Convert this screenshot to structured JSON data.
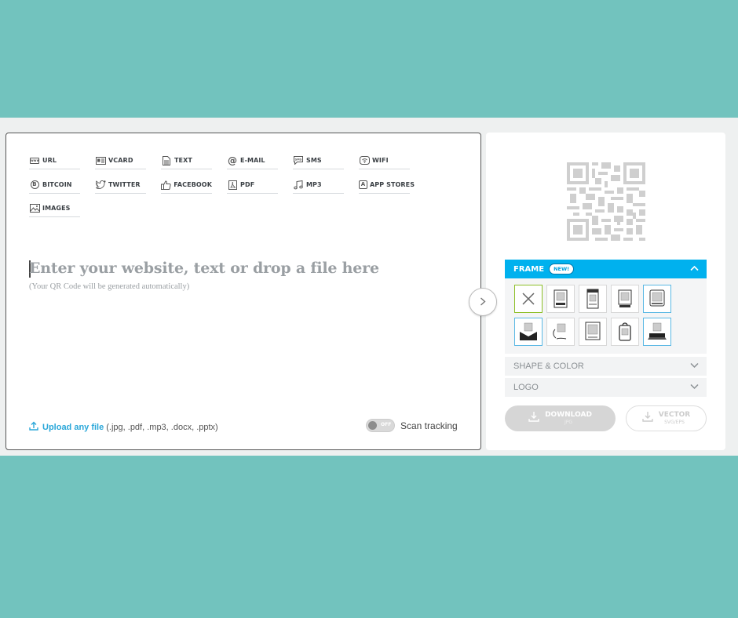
{
  "tabs": [
    {
      "label": "URL",
      "icon": "url-icon"
    },
    {
      "label": "VCARD",
      "icon": "vcard-icon"
    },
    {
      "label": "TEXT",
      "icon": "text-icon"
    },
    {
      "label": "E-MAIL",
      "icon": "email-icon"
    },
    {
      "label": "SMS",
      "icon": "sms-icon"
    },
    {
      "label": "WIFI",
      "icon": "wifi-icon"
    },
    {
      "label": "BITCOIN",
      "icon": "bitcoin-icon"
    },
    {
      "label": "TWITTER",
      "icon": "twitter-icon"
    },
    {
      "label": "FACEBOOK",
      "icon": "facebook-icon"
    },
    {
      "label": "PDF",
      "icon": "pdf-icon"
    },
    {
      "label": "MP3",
      "icon": "music-icon"
    },
    {
      "label": "APP STORES",
      "icon": "app-store-icon"
    },
    {
      "label": "IMAGES",
      "icon": "image-icon"
    }
  ],
  "editor": {
    "headline": "Enter your website, text or drop a file here",
    "subtext": "(Your QR Code will be generated automatically)"
  },
  "upload": {
    "link": "Upload any file",
    "extensions": "(.jpg, .pdf, .mp3, .docx, .pptx)"
  },
  "tracking": {
    "toggle_state": "OFF",
    "label": "Scan tracking"
  },
  "panel": {
    "frame_label": "FRAME",
    "frame_badge": "NEW!",
    "shape_color_label": "SHAPE & COLOR",
    "logo_label": "LOGO",
    "download_label": "DOWNLOAD",
    "download_format": "JPG",
    "vector_label": "VECTOR",
    "vector_format": "SVG/EPS"
  },
  "colors": {
    "background": "#72c3be",
    "accent": "#00b1ee",
    "link": "#2aa7d9",
    "selected_frame": "#8cbf26"
  }
}
